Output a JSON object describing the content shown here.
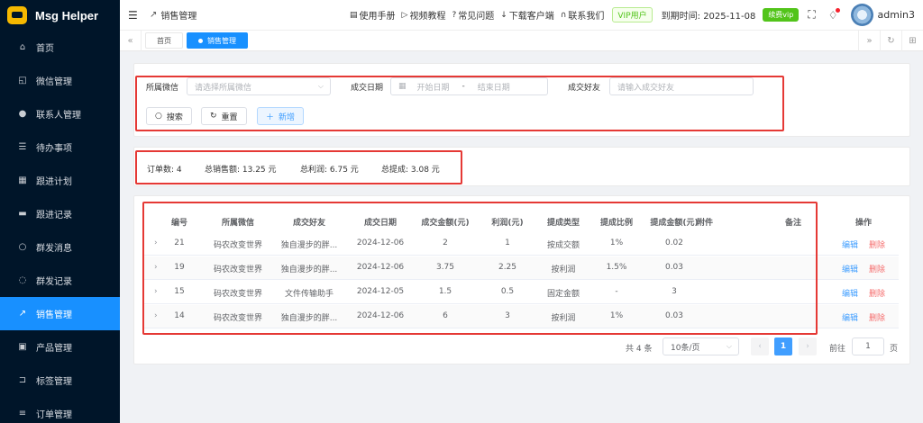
{
  "app": {
    "name": "Msg Helper"
  },
  "sidebar": {
    "items": [
      {
        "label": "首页",
        "icon": "home-icon",
        "glyph": "⌂"
      },
      {
        "label": "微信管理",
        "icon": "wechat-icon",
        "glyph": "◱"
      },
      {
        "label": "联系人管理",
        "icon": "user-icon",
        "glyph": "●"
      },
      {
        "label": "待办事项",
        "icon": "list-icon",
        "glyph": "☰"
      },
      {
        "label": "跟进计划",
        "icon": "calendar-icon",
        "glyph": "▦"
      },
      {
        "label": "跟进记录",
        "icon": "briefcase-icon",
        "glyph": "▬"
      },
      {
        "label": "群发消息",
        "icon": "message-icon",
        "glyph": "○"
      },
      {
        "label": "群发记录",
        "icon": "chat-icon",
        "glyph": "◌"
      },
      {
        "label": "销售管理",
        "icon": "chart-icon",
        "glyph": "↗"
      },
      {
        "label": "产品管理",
        "icon": "box-icon",
        "glyph": "▣"
      },
      {
        "label": "标签管理",
        "icon": "bookmark-icon",
        "glyph": "⊐"
      },
      {
        "label": "订单管理",
        "icon": "order-icon",
        "glyph": "≡"
      }
    ]
  },
  "header": {
    "breadcrumb": "销售管理",
    "links": [
      {
        "label": "使用手册",
        "icon": "manual-icon",
        "glyph": "▤"
      },
      {
        "label": "视频教程",
        "icon": "video-icon",
        "glyph": "▷"
      },
      {
        "label": "常见问题",
        "icon": "question-icon",
        "glyph": "?"
      },
      {
        "label": "下载客户端",
        "icon": "download-icon",
        "glyph": "↓"
      },
      {
        "label": "联系我们",
        "icon": "headset-icon",
        "glyph": "∩"
      }
    ],
    "vip_badge": "VIP用户",
    "expire_text": "到期时间: 2025-11-08",
    "renew_label": "续费vip",
    "username": "admin3"
  },
  "tabs": {
    "items": [
      "首页",
      "销售管理"
    ]
  },
  "filters": {
    "wechat_label": "所属微信",
    "wechat_placeholder": "请选择所属微信",
    "date_label": "成交日期",
    "date_start_placeholder": "开始日期",
    "date_sep": "-",
    "date_end_placeholder": "结束日期",
    "friend_label": "成交好友",
    "friend_placeholder": "请输入成交好友",
    "search_label": "搜索",
    "reset_label": "重置",
    "add_label": "新增"
  },
  "stats": {
    "orders": "订单数: 4",
    "sales": "总销售额: 13.25 元",
    "profit": "总利润: 6.75 元",
    "commission": "总提成: 3.08 元"
  },
  "table": {
    "headers": [
      "编号",
      "所属微信",
      "成交好友",
      "成交日期",
      "成交金额(元)",
      "利润(元)",
      "提成类型",
      "提成比例",
      "提成金额(元)",
      "附件",
      "备注",
      "操作"
    ],
    "rows": [
      {
        "id": "21",
        "wechat": "码农改变世界",
        "friend": "独自漫步的胖...",
        "date": "2024-12-06",
        "amount": "2",
        "profit": "1",
        "type": "按成交额",
        "ratio": "1%",
        "commission": "0.02"
      },
      {
        "id": "19",
        "wechat": "码农改变世界",
        "friend": "独自漫步的胖...",
        "date": "2024-12-06",
        "amount": "3.75",
        "profit": "2.25",
        "type": "按利润",
        "ratio": "1.5%",
        "commission": "0.03"
      },
      {
        "id": "15",
        "wechat": "码农改变世界",
        "friend": "文件传输助手",
        "date": "2024-12-05",
        "amount": "1.5",
        "profit": "0.5",
        "type": "固定金额",
        "ratio": "-",
        "commission": "3"
      },
      {
        "id": "14",
        "wechat": "码农改变世界",
        "friend": "独自漫步的胖...",
        "date": "2024-12-06",
        "amount": "6",
        "profit": "3",
        "type": "按利润",
        "ratio": "1%",
        "commission": "0.03"
      }
    ],
    "edit_label": "编辑",
    "delete_label": "删除"
  },
  "pagination": {
    "total": "共 4 条",
    "page_size": "10条/页",
    "current_page": "1",
    "goto_label": "前往",
    "goto_value": "1",
    "page_suffix": "页"
  }
}
